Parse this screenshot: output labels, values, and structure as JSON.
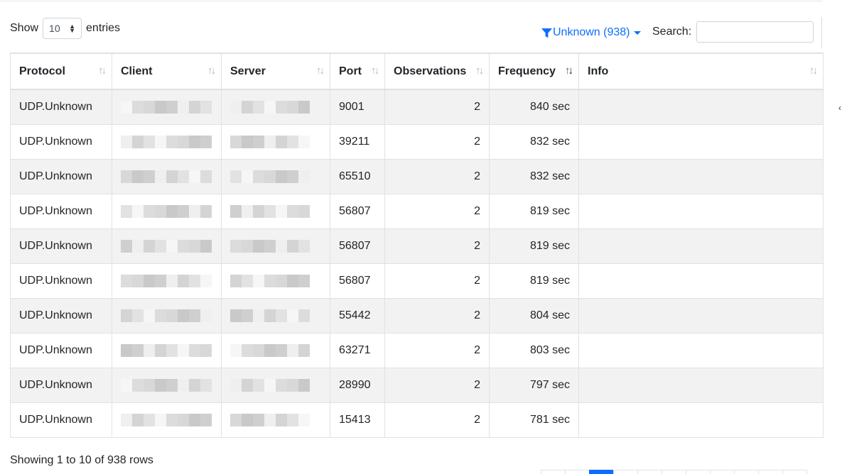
{
  "controls": {
    "show_label": "Show",
    "entries_value": "10",
    "entries_label": "entries",
    "filter_label": "Unknown (938)",
    "search_label": "Search:",
    "search_value": "",
    "accent_color": "#0d6efd"
  },
  "table": {
    "columns": [
      "Protocol",
      "Client",
      "Server",
      "Port",
      "Observations",
      "Frequency",
      "Info"
    ],
    "sorted_column": "Frequency",
    "sort_direction": "descending",
    "rows": [
      {
        "protocol": "UDP.Unknown",
        "port": "9001",
        "observations": "2",
        "frequency": "840 sec",
        "info": ""
      },
      {
        "protocol": "UDP.Unknown",
        "port": "39211",
        "observations": "2",
        "frequency": "832 sec",
        "info": ""
      },
      {
        "protocol": "UDP.Unknown",
        "port": "65510",
        "observations": "2",
        "frequency": "832 sec",
        "info": ""
      },
      {
        "protocol": "UDP.Unknown",
        "port": "56807",
        "observations": "2",
        "frequency": "819 sec",
        "info": ""
      },
      {
        "protocol": "UDP.Unknown",
        "port": "56807",
        "observations": "2",
        "frequency": "819 sec",
        "info": ""
      },
      {
        "protocol": "UDP.Unknown",
        "port": "56807",
        "observations": "2",
        "frequency": "819 sec",
        "info": ""
      },
      {
        "protocol": "UDP.Unknown",
        "port": "55442",
        "observations": "2",
        "frequency": "804 sec",
        "info": ""
      },
      {
        "protocol": "UDP.Unknown",
        "port": "63271",
        "observations": "2",
        "frequency": "803 sec",
        "info": ""
      },
      {
        "protocol": "UDP.Unknown",
        "port": "28990",
        "observations": "2",
        "frequency": "797 sec",
        "info": ""
      },
      {
        "protocol": "UDP.Unknown",
        "port": "15413",
        "observations": "2",
        "frequency": "781 sec",
        "info": ""
      }
    ]
  },
  "footer": {
    "info": "Showing 1 to 10 of 938 rows"
  }
}
